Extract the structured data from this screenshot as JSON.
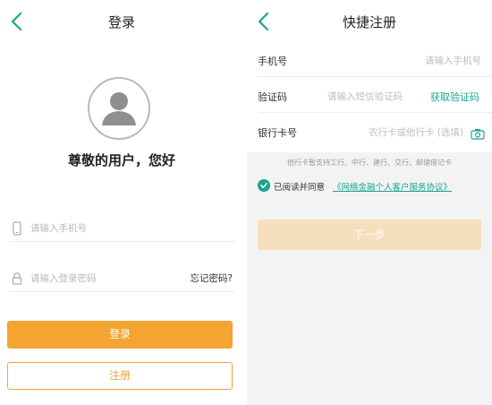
{
  "login": {
    "title": "登录",
    "greeting": "尊敬的用户，您好",
    "phone_placeholder": "请输入手机号",
    "password_placeholder": "请输入登录密码",
    "forgot_password": "忘记密码?",
    "login_button": "登录",
    "register_button": "注册"
  },
  "register": {
    "title": "快捷注册",
    "phone_label": "手机号",
    "phone_placeholder": "请输入手机号",
    "code_label": "验证码",
    "code_placeholder": "请输入短信验证码",
    "get_code": "获取验证码",
    "card_label": "银行卡号",
    "card_placeholder": "农行卡或他行卡 (选填)",
    "notice": "他行卡暂支持工行、中行、建行、交行、邮储借记卡",
    "agree_text": "已阅读并同意",
    "protocol_link": "《网络金融个人客户服务协议》",
    "next_button": "下一步"
  },
  "colors": {
    "accent_orange": "#f4a431",
    "accent_green": "#1aa58c",
    "disabled_orange": "#f6dfbd"
  },
  "icons": [
    "back-arrow-icon",
    "avatar-icon",
    "phone-icon",
    "lock-icon",
    "camera-icon",
    "checkmark-icon"
  ]
}
